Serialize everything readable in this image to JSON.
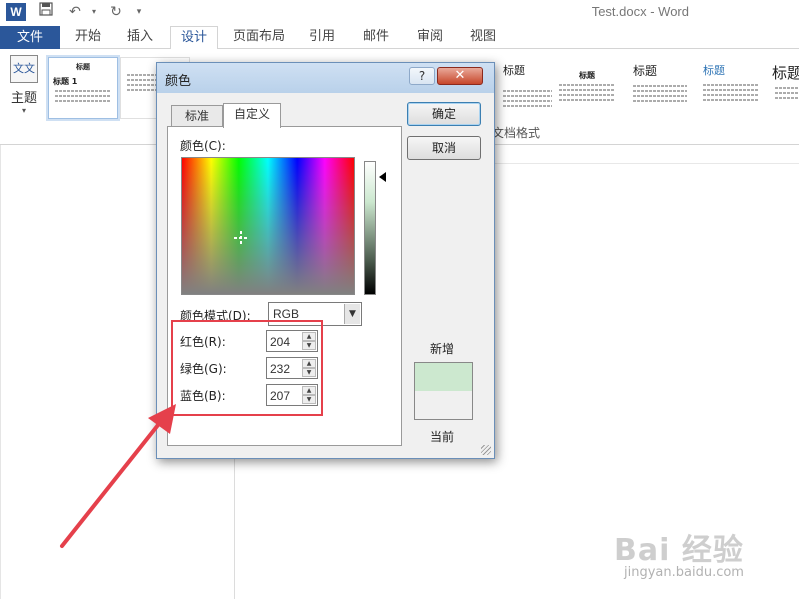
{
  "titlebar": {
    "word_icon": "W",
    "save_icon": "save-icon",
    "undo_icon": "undo-icon",
    "redo_icon": "redo-icon",
    "customize_icon": "customize-qat-icon",
    "doc_title": "Test.docx - Word"
  },
  "tabs": [
    {
      "label": "文件"
    },
    {
      "label": "开始"
    },
    {
      "label": "插入"
    },
    {
      "label": "设计"
    },
    {
      "label": "页面布局"
    },
    {
      "label": "引用"
    },
    {
      "label": "邮件"
    },
    {
      "label": "审阅"
    },
    {
      "label": "视图"
    }
  ],
  "ribbon": {
    "theme_icon_text": "文文",
    "theme_label": "主题",
    "group_label": "文档格式",
    "thumbnails": [
      {
        "title": "标题"
      },
      {
        "title": "标题"
      },
      {
        "title": "标题"
      },
      {
        "title": "标题"
      },
      {
        "title": "标题"
      }
    ],
    "selected_thumb": {
      "heading": "标题",
      "subheading": "标题 1"
    }
  },
  "dialog": {
    "title": "颜色",
    "help": "?",
    "close": "✕",
    "tabs": [
      {
        "label": "标准"
      },
      {
        "label": "自定义"
      }
    ],
    "colors_label": "颜色(C):",
    "mode_label": "颜色模式(D):",
    "mode_value": "RGB",
    "red_label": "红色(R):",
    "green_label": "绿色(G):",
    "blue_label": "蓝色(B):",
    "red": "204",
    "green": "232",
    "blue": "207",
    "ok": "确定",
    "cancel": "取消",
    "new_label": "新增",
    "current_label": "当前",
    "new_color": "#cce8cf",
    "current_color": "#f0f0f0"
  },
  "watermark": {
    "brand": "Bai 经验",
    "url": "jingyan.baidu.com"
  },
  "colors": {
    "word_blue": "#2b579a",
    "annotation_red": "#e5404b"
  }
}
